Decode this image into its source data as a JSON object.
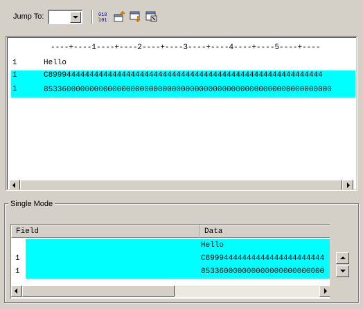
{
  "toolbar": {
    "jump_label": "Jump To:",
    "jump_value": "",
    "icons": [
      "binary-toggle-icon",
      "folder-up-icon",
      "export-icon",
      "settings-window-icon"
    ]
  },
  "viewer": {
    "ruler": "----+----1----+----2----+----3----+----4----+----5----+----",
    "records": [
      {
        "num": "1",
        "data": "Hello",
        "highlighted": false
      },
      {
        "num": "1",
        "data": "C899944444444444444444444444444444444444444444444444444444444",
        "highlighted": true
      },
      {
        "num": "1",
        "data": "853360000000000000000000000000000000000000000000000000000000000",
        "highlighted": true
      }
    ]
  },
  "single_mode": {
    "title": "Single Mode",
    "columns": [
      "Field",
      "Data"
    ],
    "rows": [
      {
        "num": "",
        "data": "Hello"
      },
      {
        "num": "1",
        "data": "C89994444444444444444444444"
      },
      {
        "num": "1",
        "data": "853360000000000000000000000"
      }
    ]
  },
  "colors": {
    "highlight": "#00ffff",
    "face": "#d4d0c8"
  }
}
